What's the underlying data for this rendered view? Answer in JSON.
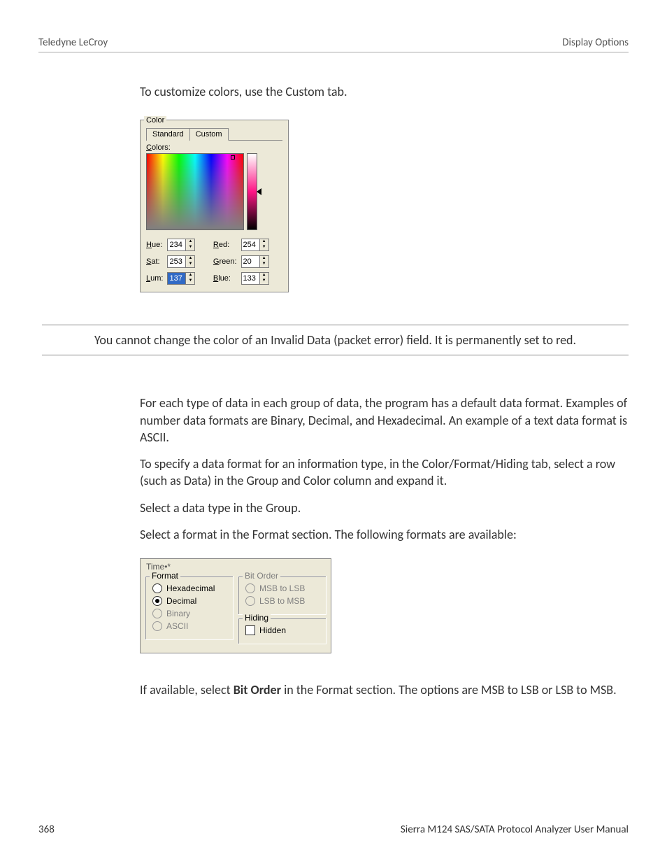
{
  "header": {
    "left": "Teledyne LeCroy",
    "right": "Display Options"
  },
  "intro": "To customize colors, use the Custom tab.",
  "color_dialog": {
    "legend": "Color",
    "tabs": {
      "standard": "Standard",
      "custom": "Custom"
    },
    "colors_label": "Colors:",
    "fields": {
      "hue": {
        "label": "Hue:",
        "ul": "H",
        "value": "234"
      },
      "sat": {
        "label": "Sat:",
        "ul": "S",
        "value": "253"
      },
      "lum": {
        "label": "Lum:",
        "ul": "L",
        "value": "137",
        "selected": true
      },
      "red": {
        "label": "Red:",
        "ul": "R",
        "value": "254"
      },
      "green": {
        "label": "Green:",
        "ul": "G",
        "value": "20"
      },
      "blue": {
        "label": "Blue:",
        "ul": "B",
        "value": "133"
      }
    }
  },
  "note": "You cannot change the color of an Invalid Data (packet error) field. It is permanently set to red.",
  "paras": {
    "p1": "For each type of data in each group of data, the program has a default data format. Examples of number data formats are Binary, Decimal, and Hexadecimal. An example of a text data format is ASCII.",
    "p2": "To specify a data format for an information type, in the Color/Format/Hiding tab, select a row (such as Data) in the Group and Color column and expand it.",
    "p3": "Select a data type in the Group.",
    "p4": "Select a format in the Format section. The following formats are available:"
  },
  "format_dialog": {
    "legend": "Time•*",
    "format_legend": "Format",
    "options": {
      "hex": "Hexadecimal",
      "dec": "Decimal",
      "bin": "Binary",
      "ascii": "ASCII"
    },
    "bitorder": {
      "legend": "Bit Order",
      "msb": "MSB to LSB",
      "lsb": "LSB to MSB"
    },
    "hiding": {
      "legend": "Hiding",
      "hidden": "Hidden"
    }
  },
  "closing": {
    "pre": "If available, select ",
    "bold": "Bit Order",
    "post": " in the Format section. The options are MSB to LSB or LSB to MSB."
  },
  "footer": {
    "page": "368",
    "manual": "Sierra M124 SAS/SATA Protocol Analyzer User Manual"
  }
}
